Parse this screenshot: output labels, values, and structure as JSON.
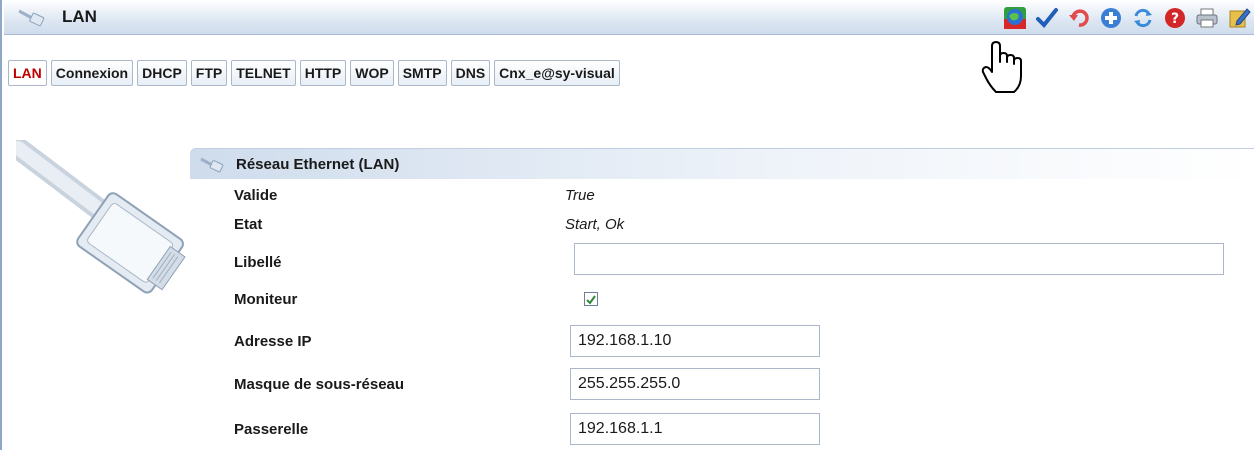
{
  "window": {
    "title": "LAN",
    "icons": [
      "cable-icon"
    ]
  },
  "toolbar": {
    "buttons": [
      {
        "name": "refresh-globe-icon"
      },
      {
        "name": "validate-check-icon"
      },
      {
        "name": "undo-icon"
      },
      {
        "name": "add-icon"
      },
      {
        "name": "reload-icon"
      },
      {
        "name": "help-icon"
      },
      {
        "name": "print-icon"
      },
      {
        "name": "edit-icon"
      }
    ]
  },
  "tabs": [
    {
      "label": "LAN",
      "active": true
    },
    {
      "label": "Connexion"
    },
    {
      "label": "DHCP"
    },
    {
      "label": "FTP"
    },
    {
      "label": "TELNET"
    },
    {
      "label": "HTTP"
    },
    {
      "label": "WOP"
    },
    {
      "label": "SMTP"
    },
    {
      "label": "DNS"
    },
    {
      "label": "Cnx_e@sy-visual"
    }
  ],
  "section": {
    "title": "Réseau Ethernet (LAN)"
  },
  "form": {
    "valide_label": "Valide",
    "valide_value": "True",
    "etat_label": "Etat",
    "etat_value": "Start, Ok",
    "libelle_label": "Libellé",
    "libelle_value": "",
    "moniteur_label": "Moniteur",
    "moniteur_checked": true,
    "ip_label": "Adresse IP",
    "ip_value": "192.168.1.10",
    "mask_label": "Masque de sous-réseau",
    "mask_value": "255.255.255.0",
    "gateway_label": "Passerelle",
    "gateway_value": "192.168.1.1"
  },
  "colors": {
    "active_tab_text": "#c00000",
    "header_gradient_start": "#cfdcec",
    "check_green": "#2e8b3a"
  }
}
